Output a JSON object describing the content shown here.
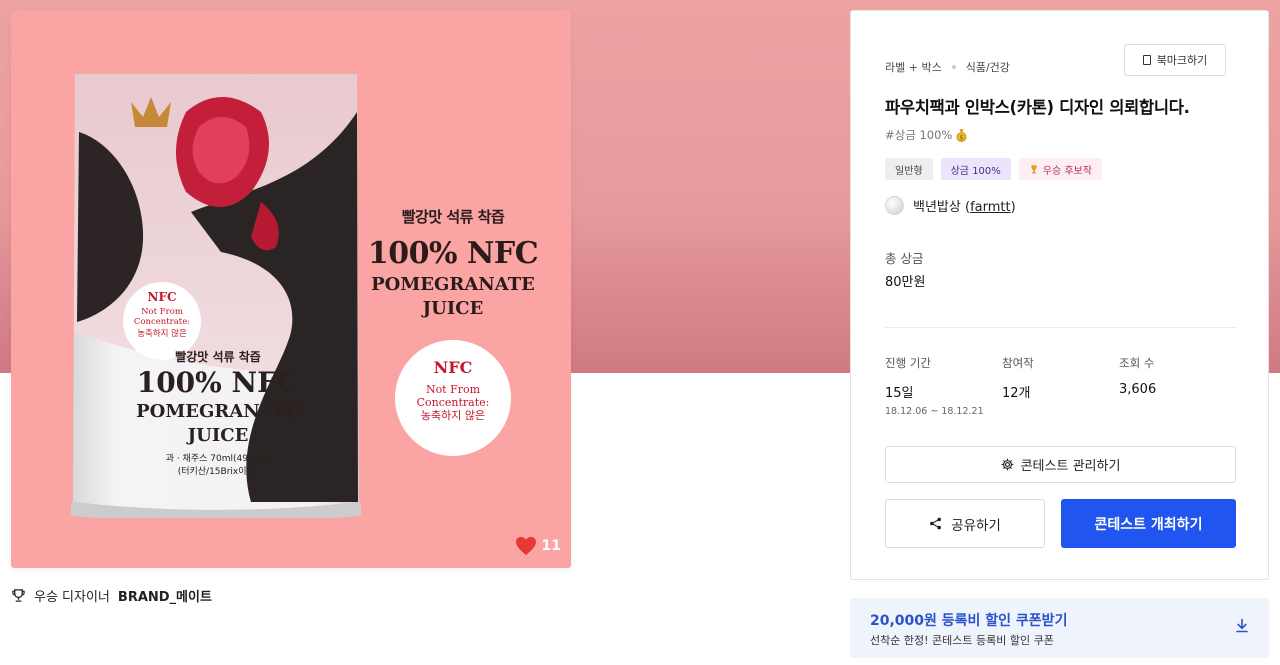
{
  "colors": {
    "accent": "#2155f0",
    "hero_bg": "#e79a9c",
    "image_bg": "#fba4a4",
    "like_heart": "#e53935",
    "coupon_text": "#2a52c9"
  },
  "artwork": {
    "pouch": {
      "nfc_title": "NFC",
      "nfc_line1": "Not From",
      "nfc_line2": "Concentrate:",
      "nfc_kor": "농축하지 않은",
      "kor_flavor": "빨강맛 석류 착즙",
      "big": "100% NFC",
      "line1": "POMEGRANATE",
      "line2": "JUICE",
      "spec1": "과 · 채주스 70ml(49Kcal)",
      "spec2": "(터키산/15Brix이상)"
    },
    "right_copy": {
      "kor_flavor": "빨강맛 석류 착즙",
      "big": "100% NFC",
      "line1": "POMEGRANATE",
      "line2": "JUICE"
    },
    "circle": {
      "title": "NFC",
      "line1": "Not From",
      "line2": "Concentrate:",
      "kor": "농축하지 않은"
    }
  },
  "likes": {
    "icon": "heart-icon",
    "count": "11"
  },
  "winner": {
    "icon": "trophy-icon",
    "prefix": "우승 디자이너",
    "name": "BRAND_메이트"
  },
  "panel": {
    "breadcrumb": [
      "라벨 + 박스",
      "식품/건강"
    ],
    "bookmark_label": "북마크하기",
    "title": "파우치팩과 인박스(카톤) 디자인 의뢰합니다.",
    "hashtag": "#상금 100%",
    "badges": [
      "일반형",
      "상금 100%",
      "우승 후보작"
    ],
    "host_name": "백년밥상",
    "host_handle": "farmtt",
    "prize_label": "총 상금",
    "prize_value": "80만원",
    "stats": {
      "period_label": "진행 기간",
      "period_value": "15일",
      "period_range": "18.12.06 ~ 18.12.21",
      "entries_label": "참여작",
      "entries_value": "12개",
      "views_label": "조회 수",
      "views_value": "3,606"
    },
    "manage_label": "콘테스트 관리하기",
    "share_label": "공유하기",
    "host_contest_label": "콘테스트 개최하기"
  },
  "coupon": {
    "title": "20,000원 등록비 할인 쿠폰받기",
    "subtitle": "선착순 한정! 콘테스트 등록비 할인 쿠폰"
  }
}
